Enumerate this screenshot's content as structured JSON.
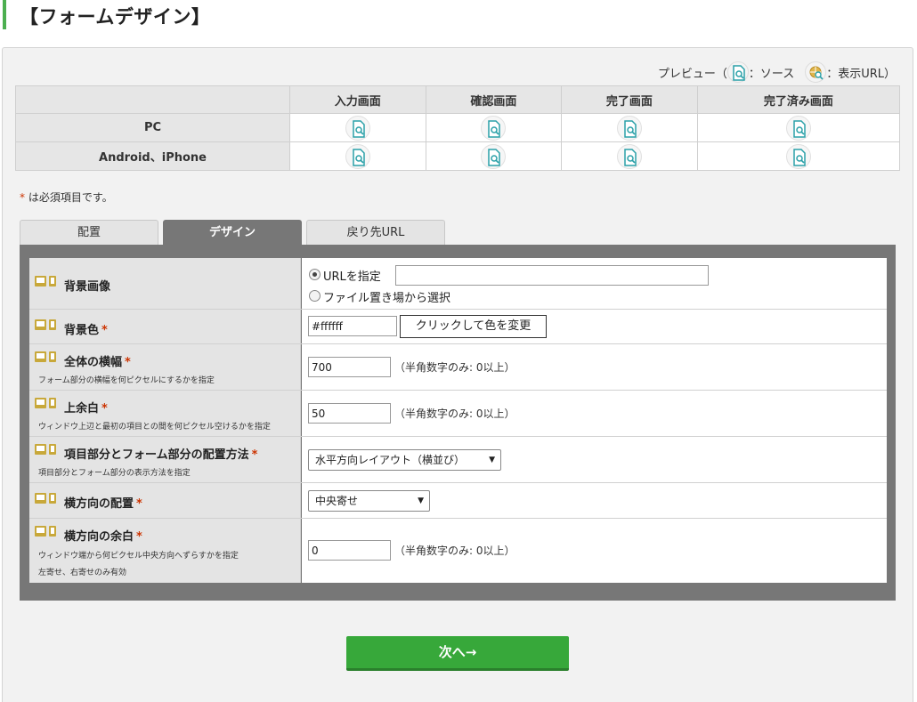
{
  "header": {
    "title": "【フォームデザイン】"
  },
  "preview": {
    "legend_prefix": "プレビュー（",
    "legend_source": "：ソース",
    "legend_url": "：表示URL）",
    "columns": [
      "入力画面",
      "確認画面",
      "完了画面",
      "完了済み画面"
    ],
    "rows": [
      "PC",
      "Android、iPhone"
    ]
  },
  "required_note": {
    "star": "*",
    "text": " は必須項目です。"
  },
  "tabs": [
    "配置",
    "デザイン",
    "戻り先URL"
  ],
  "form": {
    "bg_image": {
      "label": "背景画像",
      "option_url": "URLを指定",
      "option_file": "ファイル置き場から選択",
      "url_value": ""
    },
    "bg_color": {
      "label": "背景色",
      "star": "*",
      "value": "#ffffff",
      "button": "クリックして色を変更"
    },
    "width": {
      "label": "全体の横幅",
      "star": "*",
      "desc": "フォーム部分の横幅を何ピクセルにするかを指定",
      "value": "700",
      "hint": "（半角数字のみ: 0以上）"
    },
    "top_margin": {
      "label": "上余白",
      "star": "*",
      "desc": "ウィンドウ上辺と最初の項目との間を何ピクセル空けるかを指定",
      "value": "50",
      "hint": "（半角数字のみ: 0以上）"
    },
    "layout": {
      "label": "項目部分とフォーム部分の配置方法",
      "star": "*",
      "desc": "項目部分とフォーム部分の表示方法を指定",
      "selected": "水平方向レイアウト（横並び）"
    },
    "h_align": {
      "label": "横方向の配置",
      "star": "*",
      "selected": "中央寄せ"
    },
    "h_margin": {
      "label": "横方向の余白",
      "star": "*",
      "desc1": "ウィンドウ端から何ピクセル中央方向へずらすかを指定",
      "desc2": "左寄せ、右寄せのみ有効",
      "value": "0",
      "hint": "（半角数字のみ: 0以上）"
    }
  },
  "next_button": "次へ→",
  "colors": {
    "accent_green": "#37a83a",
    "tab_active": "#777777",
    "required": "#cc3300"
  },
  "icons": [
    "source-preview-icon",
    "url-preview-icon",
    "pc-icon",
    "smartphone-icon"
  ]
}
